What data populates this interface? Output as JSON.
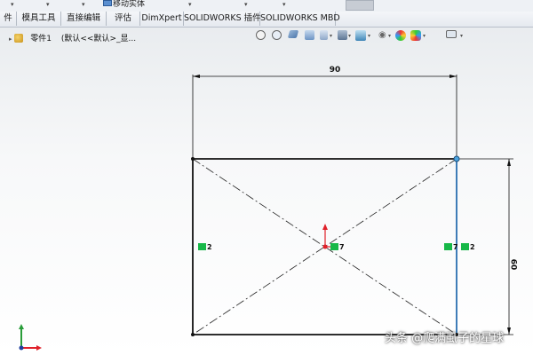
{
  "top_strip": {
    "move_label": "移动实体",
    "caret": "▾"
  },
  "tabs": [
    {
      "label": "件"
    },
    {
      "label": "模具工具"
    },
    {
      "label": "直接编辑"
    },
    {
      "label": "评估"
    },
    {
      "label": "DimXpert"
    },
    {
      "label": "SOLIDWORKS 插件"
    },
    {
      "label": "SOLIDWORKS MBD"
    }
  ],
  "feature_tree": {
    "part_label": "零件1",
    "config_path": "(默认<<默认>_显..."
  },
  "heads_up_toolbar": {
    "icons": [
      "zoom-to-fit-icon",
      "zoom-to-area-icon",
      "previous-view-icon",
      "section-view-icon",
      "view-orientation-icon",
      "display-style-icon",
      "hide-show-icon",
      "edit-appearance-icon",
      "apply-scene-icon",
      "view-settings-icon"
    ]
  },
  "sketch": {
    "dim_horizontal": "90",
    "dim_vertical": "60",
    "relations": [
      {
        "label": "2"
      },
      {
        "label": "7"
      },
      {
        "label": "7"
      },
      {
        "label": "2"
      }
    ]
  },
  "watermark": "头条 @爬满虱子的星球",
  "colors": {
    "sketch_line": "#111111",
    "selected_line": "#2a6fb0",
    "relation_green": "#17b848",
    "origin_red": "#e0202a"
  }
}
